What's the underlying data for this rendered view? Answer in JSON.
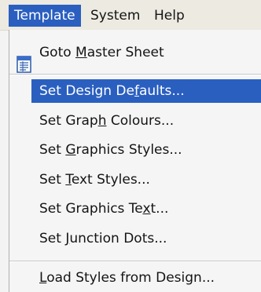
{
  "menubar": {
    "items": [
      {
        "label": "Template",
        "active": true
      },
      {
        "label": "System"
      },
      {
        "label": "Help"
      }
    ]
  },
  "menu": {
    "goto": {
      "pre": "Goto ",
      "u": "M",
      "post": "aster Sheet",
      "icon": "sheet-icon"
    },
    "items": [
      {
        "pre": "Set Design De",
        "u": "f",
        "post": "aults...",
        "highlighted": true
      },
      {
        "pre": "Set Grap",
        "u": "h",
        "post": " Colours..."
      },
      {
        "pre": "Set ",
        "u": "G",
        "post": "raphics Styles..."
      },
      {
        "pre": "Set ",
        "u": "T",
        "post": "ext Styles..."
      },
      {
        "pre": "Set Graphics Te",
        "u": "x",
        "post": "t..."
      },
      {
        "pre": "Set ",
        "u": "J",
        "post": "unction Dots..."
      }
    ],
    "load": {
      "pre": "",
      "u": "L",
      "post": "oad Styles from Design..."
    }
  },
  "colors": {
    "highlight": "#2a5fc0",
    "menubar": "#edeae1",
    "menu": "#f5f5f5"
  }
}
